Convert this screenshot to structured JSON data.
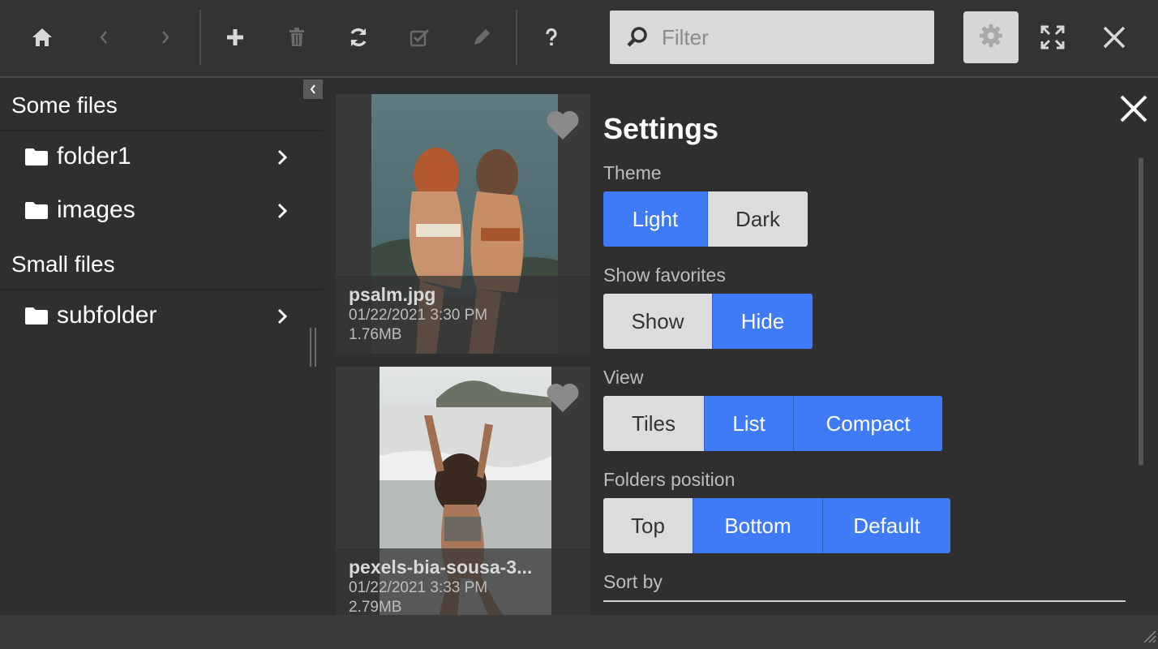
{
  "toolbar": {
    "buttons": [
      "home-icon",
      "back-icon",
      "forward-icon",
      "add-icon",
      "trash-icon",
      "refresh-icon",
      "select-icon",
      "rename-icon",
      "help-icon"
    ],
    "filter_placeholder": "Filter",
    "settings_icon": "gear-icon",
    "fullscreen_icon": "expand-icon",
    "close_icon": "close-icon"
  },
  "sidebar": {
    "sections": [
      {
        "title": "Some files",
        "folders": [
          "folder1",
          "images"
        ]
      },
      {
        "title": "Small files",
        "folders": [
          "subfolder"
        ]
      }
    ]
  },
  "files": [
    {
      "name": "psalm.jpg",
      "date": "01/22/2021 3:30 PM",
      "size": "1.76MB"
    },
    {
      "name": "pexels-bia-sousa-3...",
      "date": "01/22/2021 3:33 PM",
      "size": "2.79MB"
    }
  ],
  "settings": {
    "title": "Settings",
    "groups": [
      {
        "label": "Theme",
        "options": [
          "Light",
          "Dark"
        ],
        "selected": [
          "Light"
        ]
      },
      {
        "label": "Show favorites",
        "options": [
          "Show",
          "Hide"
        ],
        "selected": [
          "Hide"
        ]
      },
      {
        "label": "View",
        "options": [
          "Tiles",
          "List",
          "Compact"
        ],
        "selected": [
          "List",
          "Compact"
        ]
      },
      {
        "label": "Folders position",
        "options": [
          "Top",
          "Bottom",
          "Default"
        ],
        "selected": [
          "Bottom",
          "Default"
        ]
      }
    ],
    "sort_label": "Sort by"
  },
  "colors": {
    "accent": "#3f7bf7",
    "background": "#2f2f2f",
    "toolbar": "#333333"
  }
}
